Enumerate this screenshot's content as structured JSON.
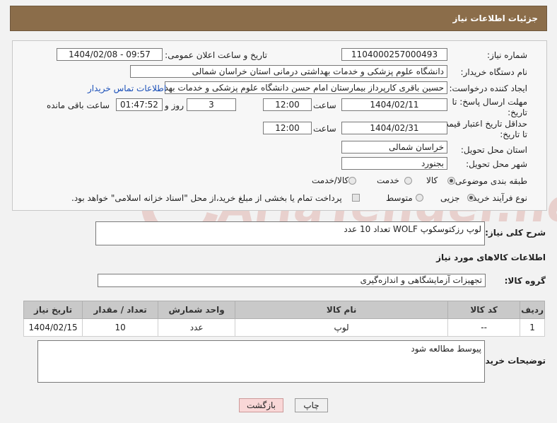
{
  "header": {
    "title": "جزئیات اطلاعات نیاز"
  },
  "form": {
    "need_number": {
      "label": "شماره نیاز:",
      "value": "1104000257000493"
    },
    "announce": {
      "label": "تاریخ و ساعت اعلان عمومی:",
      "value": "1404/02/08 - 09:57"
    },
    "buyer_org": {
      "label": "نام دستگاه خریدار:",
      "value": "دانشگاه علوم پزشکی و خدمات بهداشتی درمانی استان خراسان شمالی"
    },
    "creator": {
      "label": "ایجاد کننده درخواست:",
      "value": "حسین باقری کارپرداز بیمارستان امام حسن دانشگاه علوم پزشکی و خدمات بهد",
      "contact_link": "اطلاعات تماس خریدار"
    },
    "reply_deadline": {
      "label_line1": "مهلت ارسال پاسخ: تا",
      "label_line2": "تاریخ:",
      "date": "1404/02/11",
      "time_label": "ساعت",
      "time": "12:00",
      "days": "3",
      "days_label": "روز و",
      "remaining": "01:47:52",
      "remaining_label": "ساعت باقی مانده"
    },
    "price_validity": {
      "label_line1": "حداقل تاریخ اعتبار قیمت:",
      "label_line2": "تا تاریخ:",
      "date": "1404/02/31",
      "time_label": "ساعت",
      "time": "12:00"
    },
    "province": {
      "label": "استان محل تحویل:",
      "value": "خراسان شمالی"
    },
    "city": {
      "label": "شهر محل تحویل:",
      "value": "بجنورد"
    },
    "category": {
      "label": "طبقه بندی موضوعی:",
      "options": [
        "کالا",
        "خدمت",
        "کالا/خدمت"
      ],
      "selected": "کالا"
    },
    "process": {
      "label": "نوع فرآیند خرید :",
      "options": [
        "جزیی",
        "متوسط"
      ],
      "selected": "جزیی",
      "payment_note": "پرداخت تمام یا بخشی از مبلغ خرید،از محل \"اسناد خزانه اسلامی\" خواهد بود."
    }
  },
  "description": {
    "label": "شرح کلی نیاز:",
    "value": "لوپ رزکتوسکوپ WOLF تعداد 10 عدد"
  },
  "goods_section": {
    "title": "اطلاعات کالاهای مورد نیاز",
    "group_label": "گروه کالا:",
    "group_value": "تجهیزات آزمایشگاهی و اندازه‌گیری"
  },
  "table": {
    "headers": [
      "ردیف",
      "کد کالا",
      "نام کالا",
      "واحد شمارش",
      "تعداد / مقدار",
      "تاریخ نیاز"
    ],
    "rows": [
      [
        "1",
        "--",
        "لوپ",
        "عدد",
        "10",
        "1404/02/15"
      ]
    ]
  },
  "buyer_notes": {
    "label": "توضیحات خریدار:",
    "value": "پیوسط مطالعه شود"
  },
  "buttons": {
    "print": "چاپ",
    "back": "بازگشت"
  }
}
